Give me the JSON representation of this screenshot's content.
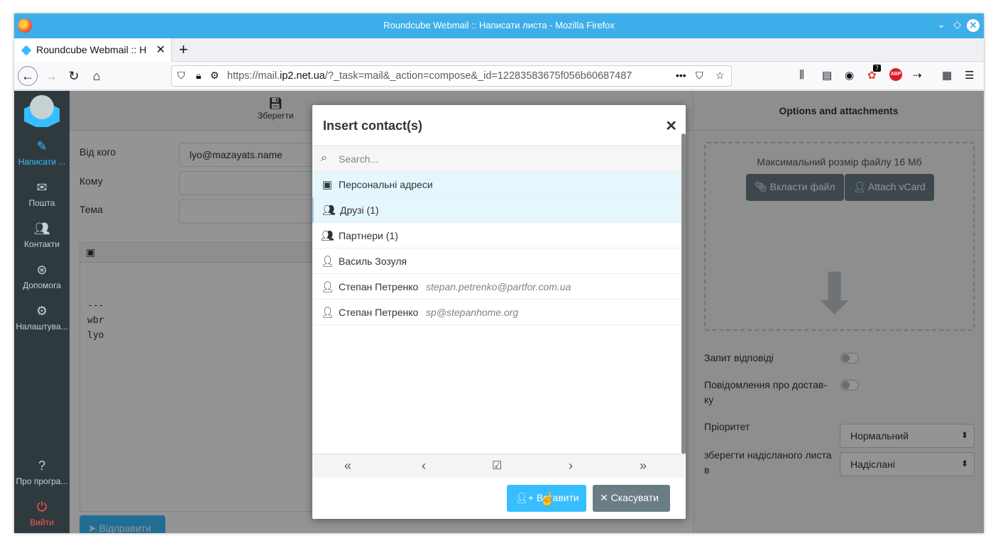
{
  "window": {
    "title": "Roundcube Webmail :: Написати листа - Mozilla Firefox"
  },
  "browser": {
    "tab_title": "Roundcube Webmail :: Н",
    "url_prefix": "https://mail.",
    "url_domain": "ip2.net.ua",
    "url_rest": "/?_task=mail&_action=compose&_id=12283583675f056b60687487",
    "addon_badge": "7"
  },
  "sidebar": {
    "compose": "Написати ...",
    "mail": "Пошта",
    "contacts": "Контакти",
    "help": "Допомога",
    "settings": "Налаштува...",
    "about": "Про програ...",
    "logout": "Вийти"
  },
  "toolbar": {
    "save": "Зберегти"
  },
  "compose": {
    "from_label": "Від кого",
    "from_value": "lyo@mazayats.name",
    "to_label": "Кому",
    "subject_label": "Тема",
    "body": "---\nwbr\nlyo",
    "send": "Відправити"
  },
  "options": {
    "title": "Options and attachments",
    "max_size": "Максимальний розмір файлу 16 Мб",
    "attach_file": "Вкласти файл",
    "attach_vcard": "Attach vCard",
    "reply_request": "Запит відповіді",
    "delivery_notice": "Повідомлення про достав-\nку",
    "priority_label": "Пріоритет",
    "priority_value": "Нормальний",
    "save_sent_label": "зберегти надісланого листа\nв",
    "save_sent_value": "Надіслані"
  },
  "dialog": {
    "title": "Insert contact(s)",
    "search_placeholder": "Search...",
    "rows": [
      {
        "name": "Персональні адреси",
        "email": "",
        "icon": "address-book-icon"
      },
      {
        "name": "Друзі (1)",
        "email": "",
        "icon": "group-icon"
      },
      {
        "name": "Партнери (1)",
        "email": "",
        "icon": "group-icon"
      },
      {
        "name": "Василь Зозуля",
        "email": "",
        "icon": "user-icon"
      },
      {
        "name": "Степан Петренко",
        "email": "stepan.petrenko@partfor.com.ua",
        "icon": "user-icon"
      },
      {
        "name": "Степан Петренко",
        "email": "sp@stepanhome.org",
        "icon": "user-icon"
      }
    ],
    "insert": "Вставити",
    "cancel": "Скасувати"
  },
  "colors": {
    "accent": "#37beff",
    "titlebar": "#3daee9",
    "sidebar": "#2f3a3f",
    "secondary_button": "#6a7d84"
  }
}
